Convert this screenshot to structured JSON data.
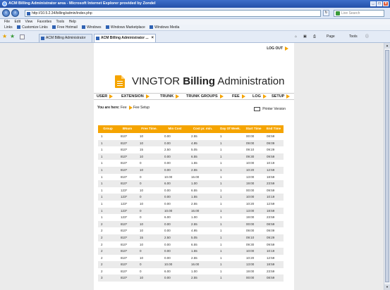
{
  "window": {
    "title": "ACM Billing Administrator area - Microsoft Internet Explorer provided by Zondel",
    "controls": [
      "_",
      "□",
      "x"
    ]
  },
  "address_bar": {
    "url": "http://10.5.2.34/billing/admin/index.php",
    "search_placeholder": "Live Search"
  },
  "menu": [
    "File",
    "Edit",
    "View",
    "Favorites",
    "Tools",
    "Help"
  ],
  "links_bar": [
    "Links",
    "Customize Links",
    "Free Hotmail",
    "Windows",
    "Windows Marketplace",
    "Windows Media"
  ],
  "tabs": [
    {
      "label": "ACM Billing Administrator area"
    },
    {
      "label": "ACM Billing Administrator ..."
    }
  ],
  "command_bar": [
    "Page",
    "Tools"
  ],
  "page": {
    "logout": "LOG OUT",
    "title_prefix": "VINGTOR",
    "title_bold": "Billing",
    "title_suffix": "Administration",
    "nav": [
      "USER",
      "EXTENSION",
      "TRUNK",
      "TRUNK GROUPS",
      "FEE",
      "LOG",
      "SETUP"
    ],
    "breadcrumb_label": "You are here:",
    "breadcrumb": [
      "Fee",
      "Fee Setup"
    ],
    "print_version": "Printer Version"
  },
  "table": {
    "headers": [
      "Group",
      "BNum",
      "Free Time.",
      "Min Cost",
      "Cost pr. min.",
      "Day Of Week.",
      "Start Time",
      "End Time"
    ],
    "rows": [
      [
        "1",
        "810*",
        "10",
        "0.00",
        "2.55",
        "1",
        "00:00",
        "08:59"
      ],
      [
        "1",
        "810*",
        "10",
        "0.00",
        "4.95",
        "1",
        "09:00",
        "09:09"
      ],
      [
        "1",
        "810*",
        "15",
        "2.50",
        "5.05",
        "1",
        "09:10",
        "09:29"
      ],
      [
        "1",
        "810*",
        "10",
        "0.00",
        "6.55",
        "1",
        "09:30",
        "09:59"
      ],
      [
        "1",
        "810*",
        "0",
        "0.00",
        "1.55",
        "1",
        "10:00",
        "10:19"
      ],
      [
        "1",
        "810*",
        "10",
        "0.00",
        "2.55",
        "1",
        "10:20",
        "12:59"
      ],
      [
        "1",
        "810*",
        "0",
        "10.00",
        "16.00",
        "1",
        "13:00",
        "18:59"
      ],
      [
        "1",
        "810*",
        "0",
        "6.00",
        "1.00",
        "1",
        "19:00",
        "23:59"
      ],
      [
        "1",
        "123*",
        "10",
        "0.00",
        "6.55",
        "1",
        "00:00",
        "09:59"
      ],
      [
        "1",
        "123*",
        "0",
        "0.00",
        "1.55",
        "1",
        "10:00",
        "10:19"
      ],
      [
        "1",
        "123*",
        "10",
        "0.00",
        "2.55",
        "1",
        "10:20",
        "12:59"
      ],
      [
        "1",
        "123*",
        "0",
        "10.00",
        "16.00",
        "1",
        "13:00",
        "18:59"
      ],
      [
        "1",
        "123*",
        "0",
        "6.00",
        "1.00",
        "1",
        "19:00",
        "23:59"
      ],
      [
        "2",
        "810*",
        "10",
        "0.00",
        "2.55",
        "1",
        "00:00",
        "08:59"
      ],
      [
        "2",
        "810*",
        "10",
        "0.00",
        "4.95",
        "1",
        "09:00",
        "09:09"
      ],
      [
        "2",
        "810*",
        "15",
        "2.50",
        "5.05",
        "1",
        "09:10",
        "09:29"
      ],
      [
        "2",
        "810*",
        "10",
        "0.00",
        "6.55",
        "1",
        "09:30",
        "09:59"
      ],
      [
        "2",
        "810*",
        "0",
        "0.00",
        "1.55",
        "1",
        "10:00",
        "10:19"
      ],
      [
        "2",
        "810*",
        "10",
        "0.00",
        "2.55",
        "1",
        "10:20",
        "12:59"
      ],
      [
        "2",
        "810*",
        "0",
        "10.00",
        "16.00",
        "1",
        "13:00",
        "18:59"
      ],
      [
        "2",
        "810*",
        "0",
        "6.00",
        "1.00",
        "1",
        "19:00",
        "23:59"
      ],
      [
        "3",
        "810*",
        "10",
        "0.00",
        "2.55",
        "1",
        "00:00",
        "08:59"
      ]
    ]
  },
  "colors": {
    "accent": "#f5a400",
    "row_alt": "#ebebeb",
    "page_bg": "#ebebeb"
  }
}
